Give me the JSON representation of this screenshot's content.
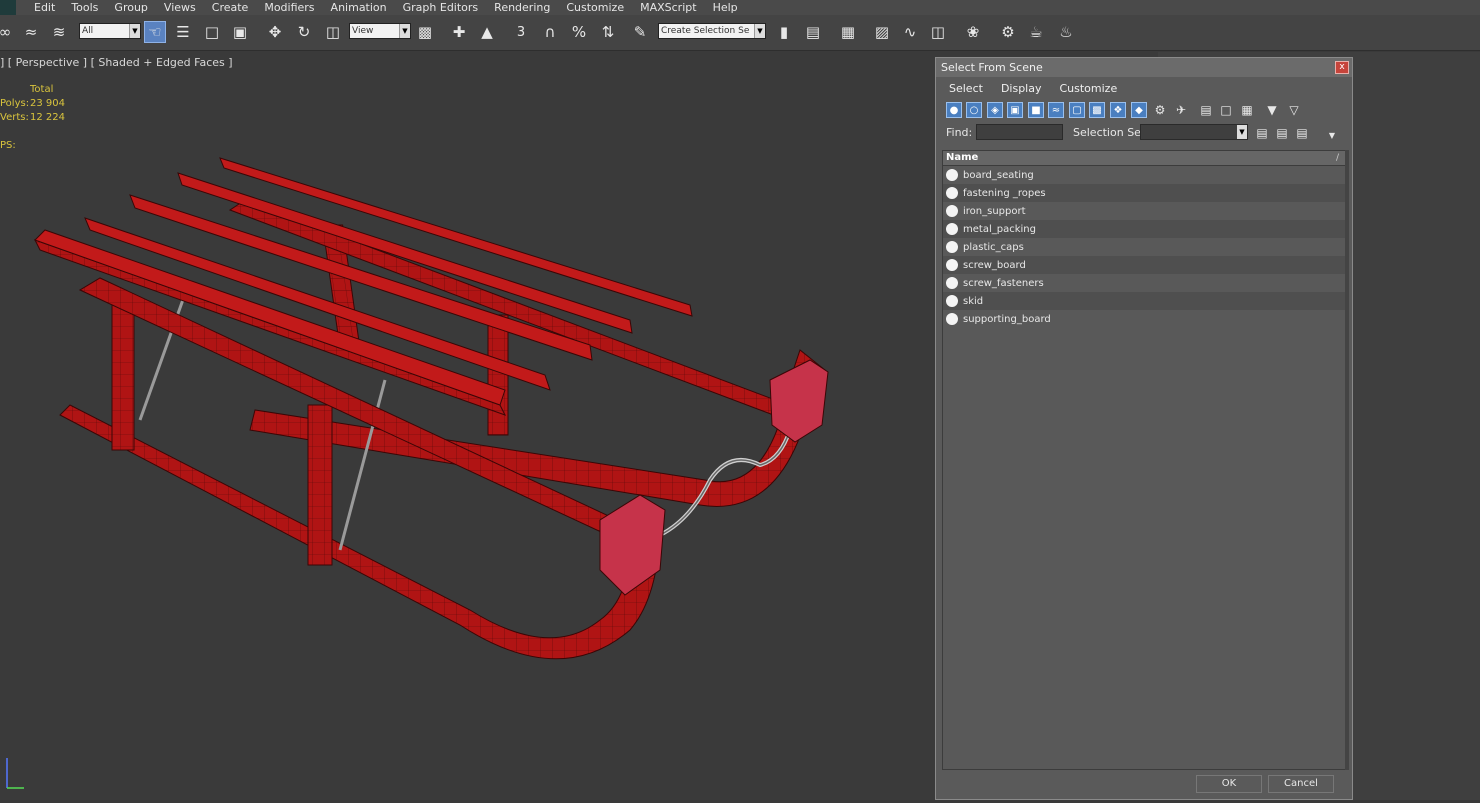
{
  "menu": [
    "Edit",
    "Tools",
    "Group",
    "Views",
    "Create",
    "Modifiers",
    "Animation",
    "Graph Editors",
    "Rendering",
    "Customize",
    "MAXScript",
    "Help"
  ],
  "toolbar": {
    "filter_value": "All",
    "refcoord_value": "View",
    "selection_set_placeholder": "Create Selection Se",
    "snap_3": "3",
    "angle_snap": "%"
  },
  "viewport": {
    "label": "] [ Perspective ] [ Shaded + Edged Faces ]",
    "stats_header": "Total",
    "polys_label": "Polys:",
    "polys_value": "23 904",
    "verts_label": "Verts:",
    "verts_value": "12 224",
    "fps_label": "PS:"
  },
  "dialog": {
    "title": "Select From Scene",
    "close": "x",
    "menu": [
      "Select",
      "Display",
      "Customize"
    ],
    "find_label": "Find:",
    "selection_set_label": "Selection Set:",
    "column_name": "Name",
    "sort_mark": "/",
    "items": [
      "board_seating",
      "fastening _ropes",
      "iron_support",
      "metal_packing",
      "plastic_caps",
      "screw_board",
      "screw_fasteners",
      "skid",
      "supporting_board"
    ],
    "ok": "OK",
    "cancel": "Cancel"
  },
  "colors": {
    "sled_red": "#b01414",
    "dialog_bg": "#5a5a5a",
    "accent_blue": "#4a7fc0"
  }
}
